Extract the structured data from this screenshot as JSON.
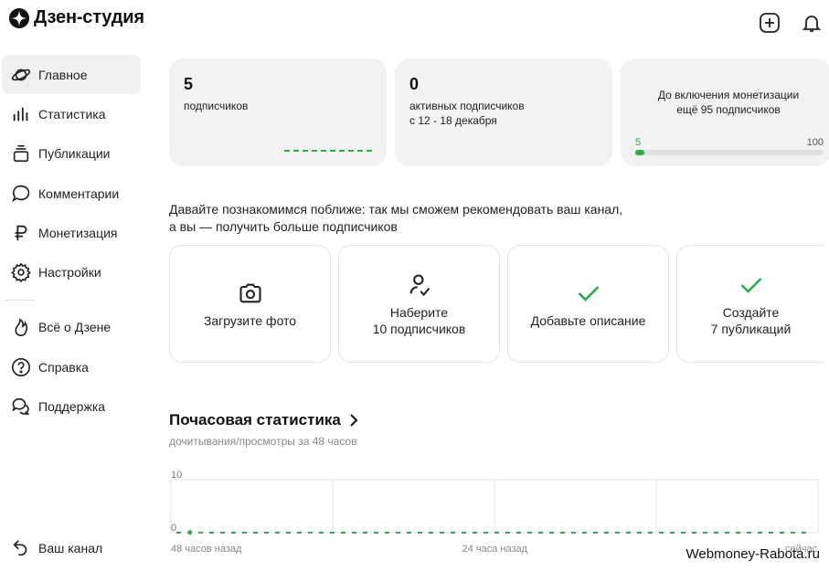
{
  "app": {
    "title": "Дзен-студия"
  },
  "sidebar": {
    "items": [
      {
        "label": "Главное",
        "icon": "planet-icon",
        "active": true
      },
      {
        "label": "Статистика",
        "icon": "bar-chart-icon"
      },
      {
        "label": "Публикации",
        "icon": "stack-icon"
      },
      {
        "label": "Комментарии",
        "icon": "comment-icon"
      },
      {
        "label": "Монетизация",
        "icon": "ruble-icon"
      },
      {
        "label": "Настройки",
        "icon": "gear-icon"
      }
    ],
    "items2": [
      {
        "label": "Всё о Дзене",
        "icon": "flame-icon"
      },
      {
        "label": "Справка",
        "icon": "help-icon"
      },
      {
        "label": "Поддержка",
        "icon": "chat-bubbles-icon"
      }
    ],
    "bottom": {
      "label": "Ваш канал",
      "icon": "back-arrow-icon"
    }
  },
  "cards": {
    "subscribers": {
      "value": "5",
      "label": "подписчиков"
    },
    "active": {
      "value": "0",
      "label": "активных подписчиков",
      "period": "с 12 - 18 декабря"
    },
    "monetization": {
      "line1": "До включения монетизации",
      "line2": "ещё 95 подписчиков",
      "current": "5",
      "target": "100",
      "progress": 0.05
    }
  },
  "intro": {
    "line1": "Давайте познакомимся поближе: так мы сможем рекомендовать ваш канал,",
    "line2": "а вы — получить больше подписчиков"
  },
  "steps": [
    {
      "line1": "Загрузите фото",
      "line2": "",
      "icon": "camera-icon",
      "done": false
    },
    {
      "line1": "Наберите",
      "line2": "10 подписчиков",
      "icon": "user-check-icon",
      "done": false
    },
    {
      "line1": "Добавьте описание",
      "line2": "",
      "icon": "checkmark-icon",
      "done": true
    },
    {
      "line1": "Создайте",
      "line2": "7 публикаций",
      "icon": "checkmark-icon",
      "done": true
    }
  ],
  "stats": {
    "title": "Почасовая статистика",
    "subtitle": "дочитывания/просмотры за 48 часов"
  },
  "chart_data": {
    "type": "line",
    "ylim": [
      0,
      10
    ],
    "y_ticks": [
      "10",
      "0"
    ],
    "x_tick_labels": [
      "48 часов назад",
      "24 часа назад",
      "сейчас"
    ],
    "series": [
      {
        "values": [
          0,
          1,
          0,
          0,
          0,
          0,
          0,
          0,
          0,
          0,
          0,
          0,
          0,
          0,
          0,
          0,
          0,
          0,
          0,
          0,
          0,
          0,
          0,
          0,
          0,
          0,
          0,
          0,
          0,
          0,
          0,
          0,
          0,
          0,
          0,
          0,
          0,
          0,
          0,
          0,
          0,
          0,
          0,
          0,
          0,
          0,
          0,
          0
        ]
      }
    ],
    "colors": {
      "line": "#2aa94d",
      "grid": "#e6e6e6"
    }
  },
  "watermark": "Webmoney-Rabota.ru"
}
